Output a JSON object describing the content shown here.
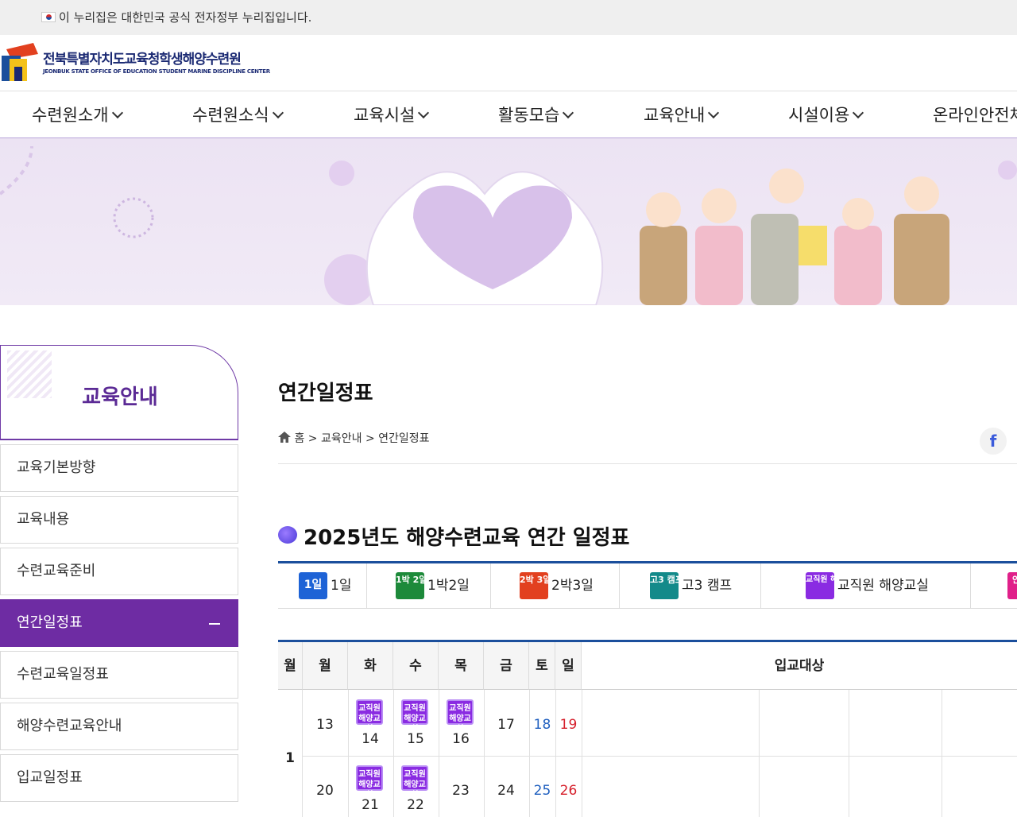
{
  "gov_banner": {
    "text": "이 누리집은 대한민국 공식 전자정부 누리집입니다."
  },
  "logo": {
    "name_kr": "전북특별자치도교육청학생해양수련원",
    "name_en": "JEONBUK STATE OFFICE OF EDUCATION STUDENT MARINE DISCIPLINE CENTER"
  },
  "gnb": [
    "수련원소개",
    "수련원소식",
    "교육시설",
    "활동모습",
    "교육안내",
    "시설이용",
    "온라인안전체"
  ],
  "sidebar": {
    "title": "교육안내",
    "items": [
      "교육기본방향",
      "교육내용",
      "수련교육준비",
      "연간일정표",
      "수련교육일정표",
      "해양수련교육안내",
      "입교일정표"
    ],
    "active_index": 3
  },
  "page": {
    "title": "연간일정표",
    "breadcrumb": {
      "home": "홈",
      "sep1": ">",
      "level1": "교육안내",
      "sep2": ">",
      "level2": "연간일정표"
    },
    "share_icon": "f"
  },
  "section": {
    "title": "2025년도 해양수련교육 연간 일정표"
  },
  "legend": [
    {
      "badge": "1일",
      "label": "1일",
      "color": "#1e63d6"
    },
    {
      "badge": "1박 2일",
      "label": "1박2일",
      "color": "#1d8a3a"
    },
    {
      "badge": "2박 3일",
      "label": "2박3일",
      "color": "#e2401f"
    },
    {
      "badge": "고3 캠프",
      "label": "고3 캠프",
      "color": "#138a8a"
    },
    {
      "badge": "교직원 해양교실",
      "label": "교직원 해양교실",
      "color": "#8a2be2"
    },
    {
      "badge": "안 전",
      "label": "",
      "color": "#e0208a"
    }
  ],
  "calendar": {
    "headers": [
      "월",
      "월",
      "화",
      "수",
      "목",
      "금",
      "토",
      "일",
      "입교대상"
    ],
    "month": "1",
    "event_label": "교직원 해양교실",
    "weeks": [
      {
        "mon": "13",
        "tue": "14",
        "wed": "15",
        "thu": "16",
        "fri": "17",
        "sat": "18",
        "sun": "19",
        "events": [
          "tue",
          "wed",
          "thu"
        ]
      },
      {
        "mon": "20",
        "tue": "21",
        "wed": "22",
        "thu": "23",
        "fri": "24",
        "sat": "25",
        "sun": "26",
        "events": [
          "tue",
          "wed"
        ]
      }
    ]
  }
}
